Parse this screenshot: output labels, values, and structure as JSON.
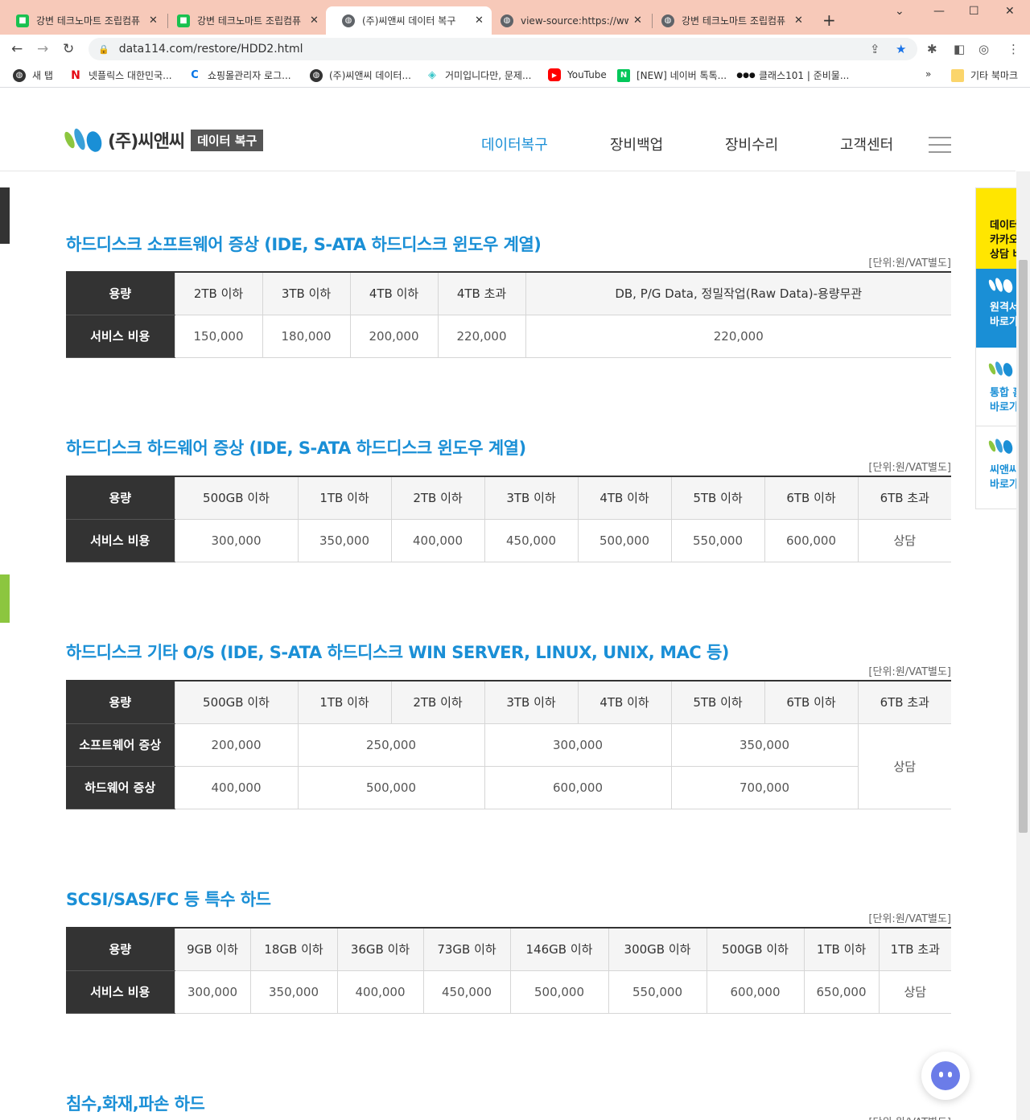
{
  "browser": {
    "tabs": [
      {
        "title": "강변 테크노마트 조립컴퓨",
        "icon": "green-square-icon"
      },
      {
        "title": "강변 테크노마트 조립컴퓨",
        "icon": "green-square-icon"
      },
      {
        "title": "(주)씨앤씨 데이터 복구",
        "icon": "globe-icon"
      },
      {
        "title": "view-source:https://www",
        "icon": "globe-icon"
      },
      {
        "title": "강변 테크노마트 조립컴퓨",
        "icon": "globe-icon"
      }
    ],
    "active_tab": 2,
    "url": "data114.com/restore/HDD2.html",
    "bookmarks": [
      {
        "label": "새 탭",
        "icon": "globe-icon"
      },
      {
        "label": "넷플릭스 대한민국...",
        "icon": "netflix-icon"
      },
      {
        "label": "쇼핑몰관리자 로그...",
        "icon": "cafe24-icon"
      },
      {
        "label": "(주)씨앤씨 데이터...",
        "icon": "globe-icon"
      },
      {
        "label": "거미입니다만, 문제...",
        "icon": "teal-icon"
      },
      {
        "label": "YouTube",
        "icon": "youtube-icon"
      },
      {
        "label": "[NEW] 네이버 톡톡...",
        "icon": "naver-icon"
      },
      {
        "label": "클래스101 | 준비물...",
        "icon": "class101-icon"
      }
    ],
    "other_bookmarks": "기타 북마크",
    "chevron": "»"
  },
  "site": {
    "brand": "(주)씨앤씨",
    "badge": "데이터 복구",
    "nav": [
      "데이터복구",
      "장비백업",
      "장비수리",
      "고객센터"
    ],
    "active_nav": 0
  },
  "quick_menu": {
    "kakao": [
      "데이터",
      "카카오",
      "상담 바"
    ],
    "remote": [
      "원격서",
      "바로가"
    ],
    "total": [
      "통합 홈",
      "바로가"
    ],
    "cns": [
      "씨앤씨",
      "바로가"
    ]
  },
  "unit_label": "[단위:원/VAT별도]",
  "sections": [
    {
      "title": "하드디스크 소프트웨어 증상 (IDE, S-ATA 하드디스크 윈도우 계열)",
      "header_label": "용량",
      "columns": [
        "2TB 이하",
        "3TB 이하",
        "4TB 이하",
        "4TB 초과",
        "DB, P/G Data, 정밀작업(Raw Data)-용량무관"
      ],
      "row_label": "서비스 비용",
      "values": [
        "150,000",
        "180,000",
        "200,000",
        "220,000",
        "220,000"
      ]
    },
    {
      "title": "하드디스크 하드웨어 증상 (IDE, S-ATA 하드디스크 윈도우 계열)",
      "header_label": "용량",
      "columns": [
        "500GB 이하",
        "1TB 이하",
        "2TB 이하",
        "3TB 이하",
        "4TB 이하",
        "5TB 이하",
        "6TB 이하",
        "6TB 초과"
      ],
      "row_label": "서비스 비용",
      "values": [
        "300,000",
        "350,000",
        "400,000",
        "450,000",
        "500,000",
        "550,000",
        "600,000",
        "상담"
      ]
    },
    {
      "title": "하드디스크 기타 O/S (IDE, S-ATA 하드디스크 WIN SERVER, LINUX, UNIX, MAC 등)",
      "header_label": "용량",
      "columns": [
        "500GB 이하",
        "1TB 이하",
        "2TB 이하",
        "3TB 이하",
        "4TB 이하",
        "5TB 이하",
        "6TB 이하",
        "6TB 초과"
      ],
      "rows": [
        {
          "label": "소프트웨어 증상",
          "values": [
            "200,000",
            "250,000",
            "300,000",
            "350,000"
          ]
        },
        {
          "label": "하드웨어 증상",
          "values": [
            "400,000",
            "500,000",
            "600,000",
            "700,000"
          ]
        }
      ],
      "merged_value": "상담"
    },
    {
      "title": "SCSI/SAS/FC 등 특수 하드",
      "header_label": "용량",
      "columns": [
        "9GB 이하",
        "18GB 이하",
        "36GB 이하",
        "73GB 이하",
        "146GB 이하",
        "300GB 이하",
        "500GB 이하",
        "1TB 이하",
        "1TB 초과"
      ],
      "row_label": "서비스 비용",
      "values": [
        "300,000",
        "350,000",
        "400,000",
        "450,000",
        "500,000",
        "550,000",
        "600,000",
        "650,000",
        "상담"
      ]
    },
    {
      "title": "침수,화재,파손 하드"
    }
  ],
  "colors": {
    "accent": "#1a8fd6",
    "table_head": "#333333",
    "tabbar": "#f7c9b9",
    "kakao": "#ffe600"
  }
}
